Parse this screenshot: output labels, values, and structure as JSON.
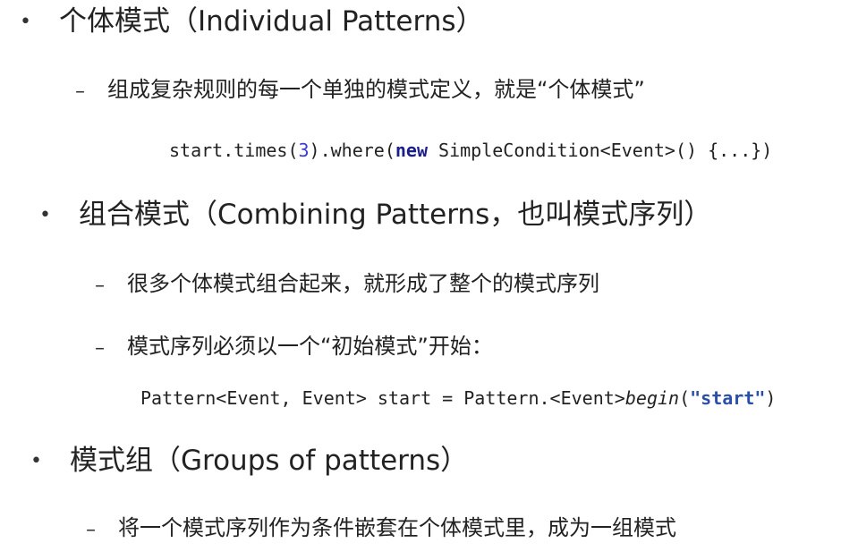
{
  "bullet_glyph": "•",
  "dash_glyph": "–",
  "sections": [
    {
      "title": "个体模式（Individual Patterns）",
      "items": [
        "组成复杂规则的每一个单独的模式定义，就是“个体模式”"
      ],
      "code": {
        "prefix": "start.times(",
        "number": "3",
        "middle": ").where(",
        "keyword": "new",
        "suffix": " SimpleCondition<Event>() {...})"
      }
    },
    {
      "title": "组合模式（Combining Patterns，也叫模式序列）",
      "items": [
        "很多个体模式组合起来，就形成了整个的模式序列",
        "模式序列必须以一个“初始模式”开始："
      ],
      "code": {
        "prefix": "Pattern<Event, Event> start = Pattern.<Event>",
        "method": "begin",
        "open": "(",
        "string": "\"start\"",
        "close": ")"
      }
    },
    {
      "title": "模式组（Groups of patterns）",
      "items": [
        "将一个模式序列作为条件嵌套在个体模式里，成为一组模式"
      ]
    }
  ]
}
